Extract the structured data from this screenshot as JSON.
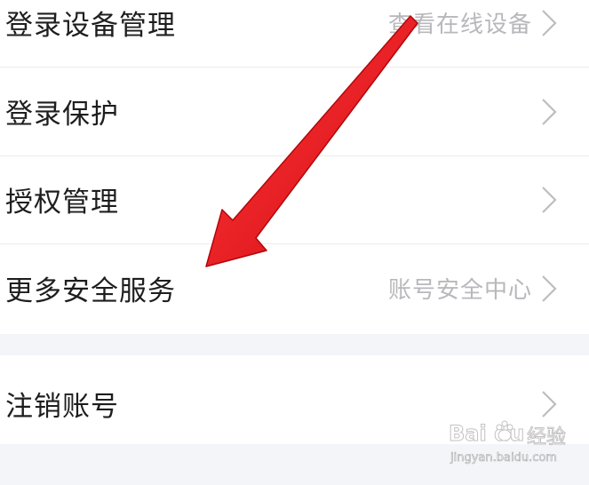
{
  "settings": {
    "rows": [
      {
        "label": "登录设备管理",
        "value": "查看在线设备"
      },
      {
        "label": "登录保护",
        "value": ""
      },
      {
        "label": "授权管理",
        "value": ""
      },
      {
        "label": "更多安全服务",
        "value": "账号安全中心"
      }
    ],
    "cancel_row": {
      "label": "注销账号",
      "value": ""
    }
  },
  "watermark": {
    "brand": "Bai du",
    "brand_cn": "经验",
    "url": "jingyan.baidu.com"
  },
  "icons": {
    "row_chevron": "chevron-right-icon",
    "annotation": "red-arrow-icon",
    "watermark_paw": "baidu-paw-icon"
  },
  "colors": {
    "background": "#f4f5f8",
    "card": "#ffffff",
    "label_text": "#1e1e1e",
    "value_text": "#b8b8bc",
    "arrow": "#e8141e"
  }
}
